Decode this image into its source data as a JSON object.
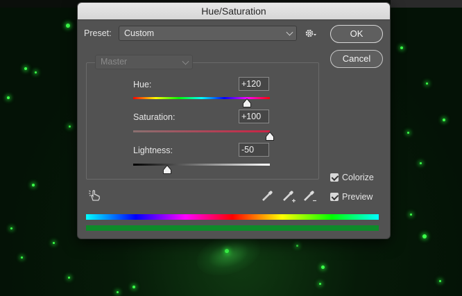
{
  "dialog": {
    "title": "Hue/Saturation",
    "preset_label": "Preset:",
    "preset_value": "Custom",
    "channel_value": "Master",
    "ok_label": "OK",
    "cancel_label": "Cancel"
  },
  "sliders": {
    "hue": {
      "label": "Hue:",
      "value": "+120",
      "min": -180,
      "max": 180,
      "num": 120
    },
    "saturation": {
      "label": "Saturation:",
      "value": "+100",
      "min": -100,
      "max": 100,
      "num": 100
    },
    "lightness": {
      "label": "Lightness:",
      "value": "-50",
      "min": -100,
      "max": 100,
      "num": -50
    }
  },
  "options": {
    "colorize_label": "Colorize",
    "colorize_checked": true,
    "preview_label": "Preview",
    "preview_checked": true
  },
  "icons": {
    "settings": "gear-icon",
    "targeted_adjust": "hand-pointer-icon",
    "eyedropper": "eyedropper-icon",
    "eyedropper_add": "eyedropper-plus-icon",
    "eyedropper_subtract": "eyedropper-minus-icon"
  },
  "colors": {
    "colorize_result": "#0e8a2a"
  }
}
